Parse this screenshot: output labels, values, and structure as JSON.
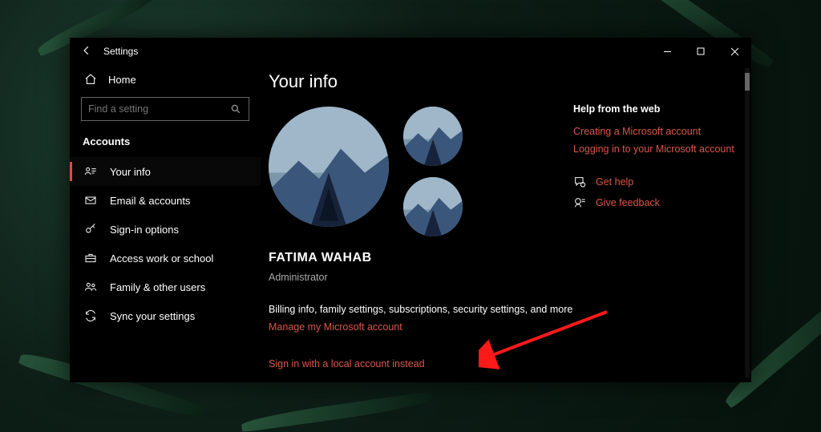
{
  "window": {
    "title": "Settings"
  },
  "sidebar": {
    "home": "Home",
    "search_placeholder": "Find a setting",
    "section": "Accounts",
    "items": [
      {
        "label": "Your info"
      },
      {
        "label": "Email & accounts"
      },
      {
        "label": "Sign-in options"
      },
      {
        "label": "Access work or school"
      },
      {
        "label": "Family & other users"
      },
      {
        "label": "Sync your settings"
      }
    ]
  },
  "page": {
    "title": "Your info",
    "user_name": "FATIMA WAHAB",
    "user_role": "Administrator",
    "billing_text": "Billing info, family settings, subscriptions, security settings, and more",
    "manage_link": "Manage my Microsoft account",
    "local_link": "Sign in with a local account instead"
  },
  "help": {
    "header": "Help from the web",
    "links": [
      "Creating a Microsoft account",
      "Logging in to your Microsoft account"
    ],
    "actions": [
      {
        "label": "Get help"
      },
      {
        "label": "Give feedback"
      }
    ]
  }
}
